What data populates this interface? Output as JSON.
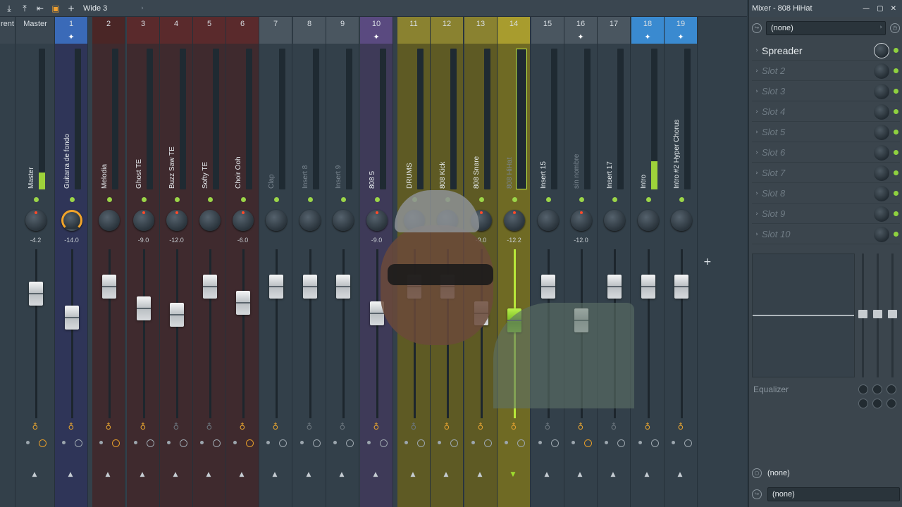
{
  "toolbar": {
    "title": "Wide 3",
    "icons": [
      "arrow-down-icon",
      "arrow-up-icon",
      "skip-icon",
      "layout-icon",
      "add-icon"
    ]
  },
  "window": {
    "title": "Mixer - 808 HiHat"
  },
  "colors": {
    "accent_orange": "#f0a030",
    "green": "#9bd548",
    "selected_strip": "#7d7826"
  },
  "strips": [
    {
      "num": "rent",
      "name": "",
      "pan": "",
      "vol": 0.0,
      "level": 0.0,
      "bulb": false,
      "clock": false,
      "color": "#3b4751"
    },
    {
      "num": "Master",
      "name": "Master",
      "pan": "-4.2",
      "vol": 0.78,
      "level": 0.12,
      "bulb": true,
      "clock": true,
      "color": "#3b4751"
    },
    {
      "num": "1",
      "name": "Guitarra de fondo",
      "pan": "-14.0",
      "vol": 0.62,
      "level": 0.0,
      "bulb": true,
      "clock": false,
      "color": "#3a6ab8",
      "route": true
    },
    {
      "num": "2",
      "name": "Melodia",
      "pan": "",
      "vol": 0.83,
      "level": 0.0,
      "bulb": true,
      "clock": true,
      "color": "#4a2626"
    },
    {
      "num": "3",
      "name": "Ghost TE",
      "pan": "-9.0",
      "vol": 0.68,
      "level": 0.0,
      "bulb": true,
      "clock": false,
      "color": "#5a2a2c"
    },
    {
      "num": "4",
      "name": "Buzz Saw TE",
      "pan": "-12.0",
      "vol": 0.64,
      "level": 0.0,
      "bulb": false,
      "clock": false,
      "color": "#5a2a2c"
    },
    {
      "num": "5",
      "name": "Softy TE",
      "pan": "",
      "vol": 0.83,
      "level": 0.0,
      "bulb": false,
      "clock": false,
      "color": "#5a2a2c"
    },
    {
      "num": "6",
      "name": "Choir Ooh",
      "pan": "-6.0",
      "vol": 0.72,
      "level": 0.0,
      "bulb": true,
      "clock": true,
      "color": "#5a2a2c"
    },
    {
      "num": "7",
      "name": "Clap",
      "pan": "",
      "vol": 0.83,
      "level": 0.0,
      "bulb": true,
      "clock": false,
      "color": "#4a5660"
    },
    {
      "num": "8",
      "name": "Insert 8",
      "pan": "",
      "vol": 0.83,
      "level": 0.0,
      "bulb": false,
      "clock": false,
      "color": "#4a5660"
    },
    {
      "num": "9",
      "name": "Insert 9",
      "pan": "",
      "vol": 0.83,
      "level": 0.0,
      "bulb": false,
      "clock": false,
      "color": "#4a5660"
    },
    {
      "num": "10",
      "name": "808 5",
      "pan": "-9.0",
      "vol": 0.65,
      "level": 0.0,
      "bulb": true,
      "clock": false,
      "color": "#5a4a80",
      "route": true
    },
    {
      "num": "11",
      "name": "DRUMS",
      "pan": "",
      "vol": 0.83,
      "level": 0.0,
      "bulb": false,
      "clock": false,
      "color": "#8a8230"
    },
    {
      "num": "12",
      "name": "808 Kick",
      "pan": "",
      "vol": 0.83,
      "level": 0.0,
      "bulb": true,
      "clock": false,
      "color": "#8a8230"
    },
    {
      "num": "13",
      "name": "808 Snare",
      "pan": "-9.0",
      "vol": 0.65,
      "level": 0.0,
      "bulb": true,
      "clock": false,
      "color": "#8a8230"
    },
    {
      "num": "14",
      "name": "808 HiHat",
      "pan": "-12.2",
      "vol": 0.6,
      "level": 0.0,
      "bulb": true,
      "clock": false,
      "color": "#a89c2e",
      "selected": true
    },
    {
      "num": "15",
      "name": "Insert 15",
      "pan": "",
      "vol": 0.83,
      "level": 0.0,
      "bulb": false,
      "clock": false,
      "color": "#4a5660"
    },
    {
      "num": "16",
      "name": "sin nombre",
      "pan": "-12.0",
      "vol": 0.6,
      "level": 0.0,
      "bulb": true,
      "clock": true,
      "color": "#4a5660",
      "route": true
    },
    {
      "num": "17",
      "name": "Insert 17",
      "pan": "",
      "vol": 0.83,
      "level": 0.0,
      "bulb": false,
      "clock": false,
      "color": "#4a5660"
    },
    {
      "num": "18",
      "name": "Intro",
      "pan": "",
      "vol": 0.83,
      "level": 0.2,
      "bulb": true,
      "clock": false,
      "color": "#3a8ad0",
      "route": true
    },
    {
      "num": "19",
      "name": "Intro #2 Hyper Chorus",
      "pan": "",
      "vol": 0.83,
      "level": 0.0,
      "bulb": true,
      "clock": false,
      "color": "#3a8ad0",
      "route": true
    }
  ],
  "panel": {
    "preset": "(none)",
    "slots": [
      {
        "name": "Spreader",
        "filled": true
      },
      {
        "name": "Slot 2"
      },
      {
        "name": "Slot 3"
      },
      {
        "name": "Slot 4"
      },
      {
        "name": "Slot 5"
      },
      {
        "name": "Slot 6"
      },
      {
        "name": "Slot 7"
      },
      {
        "name": "Slot 8"
      },
      {
        "name": "Slot 9"
      },
      {
        "name": "Slot 10"
      }
    ],
    "eq_label": "Equalizer",
    "input": "(none)",
    "output": "(none)"
  }
}
